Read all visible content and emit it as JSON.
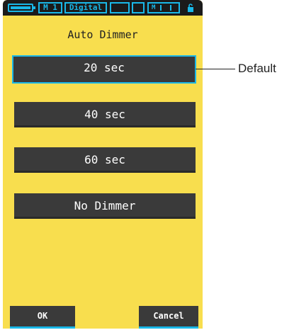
{
  "status_bar": {
    "memory": "M 1",
    "mode": "Digital",
    "channel": "M",
    "accent_color": "#19b8e8"
  },
  "icons": {
    "battery": "battery-icon",
    "lock": "lock-icon"
  },
  "screen": {
    "title": "Auto Dimmer",
    "background_color": "#f8de4e",
    "options": [
      {
        "label": "20 sec",
        "selected": true
      },
      {
        "label": "40 sec",
        "selected": false
      },
      {
        "label": "60 sec",
        "selected": false
      },
      {
        "label": "No Dimmer",
        "selected": false
      }
    ],
    "ok_label": "OK",
    "cancel_label": "Cancel"
  },
  "callout": {
    "label": "Default"
  }
}
